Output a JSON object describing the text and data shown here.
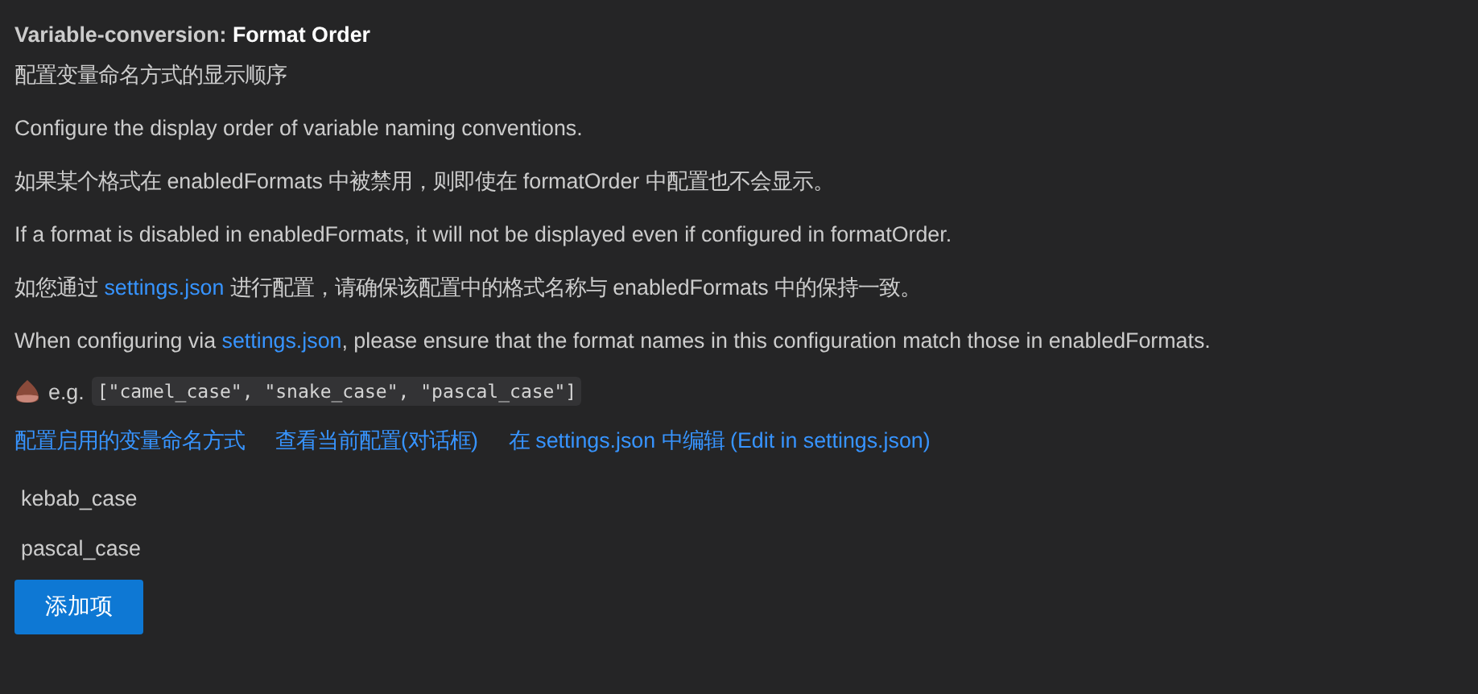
{
  "setting": {
    "category": "Variable-conversion: ",
    "name": "Format Order"
  },
  "description": [
    [
      {
        "kind": "text",
        "text": "配置变量命名方式的显示顺序"
      }
    ],
    [
      {
        "kind": "text",
        "text": "Configure the display order of variable naming conventions."
      }
    ],
    [
      {
        "kind": "text",
        "text": "如果某个格式在 enabledFormats 中被禁用，则即使在 formatOrder 中配置也不会显示。"
      }
    ],
    [
      {
        "kind": "text",
        "text": "If a format is disabled in enabledFormats, it will not be displayed even if configured in formatOrder."
      }
    ],
    [
      {
        "kind": "text",
        "text": "如您通过 "
      },
      {
        "kind": "link",
        "text": "settings.json"
      },
      {
        "kind": "text",
        "text": " 进行配置，请确保该配置中的格式名称与 enabledFormats 中的保持一致。"
      }
    ],
    [
      {
        "kind": "text",
        "text": "When configuring via "
      },
      {
        "kind": "link",
        "text": "settings.json"
      },
      {
        "kind": "text",
        "text": ", please ensure that the format names in this configuration match those in enabledFormats."
      }
    ]
  ],
  "example": {
    "label": "e.g.",
    "code": "[\"camel_case\", \"snake_case\", \"pascal_case\"]"
  },
  "actions": [
    "配置启用的变量命名方式",
    "查看当前配置(对话框)",
    "在 settings.json 中编辑 (Edit in settings.json)"
  ],
  "items": [
    "kebab_case",
    "pascal_case"
  ],
  "add_button": "添加项"
}
